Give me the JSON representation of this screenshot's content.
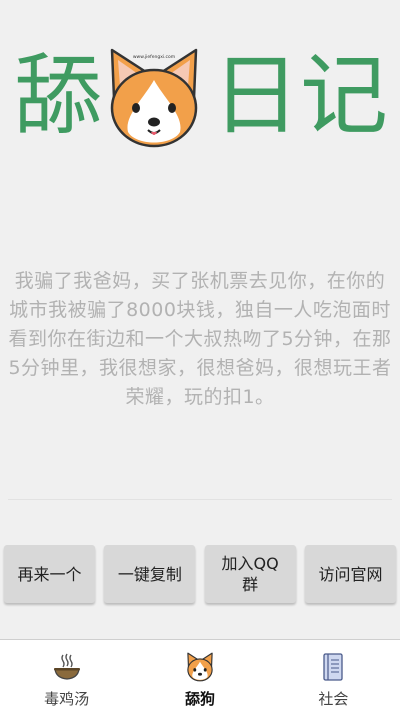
{
  "logo": {
    "char1": "舔",
    "char2": "日",
    "char3": "记",
    "green": "#3f9b61",
    "dog_caption": "www.jiefengxi.com"
  },
  "quote": {
    "text": "我骗了我爸妈，买了张机票去见你，在你的城市我被骗了8000块钱，独自一人吃泡面时看到你在街边和一个大叔热吻了5分钟，在那5分钟里，我很想家，很想爸妈，很想玩王者荣耀，玩的扣1。"
  },
  "actions": {
    "again": "再来一个",
    "copy": "一键复制",
    "join_qq": "加入QQ群",
    "visit_site": "访问官网"
  },
  "nav": {
    "items": [
      {
        "label": "毒鸡汤",
        "icon": "soup-bowl-icon"
      },
      {
        "label": "舔狗",
        "icon": "corgi-icon",
        "active": true
      },
      {
        "label": "社会",
        "icon": "notebook-icon"
      }
    ]
  }
}
